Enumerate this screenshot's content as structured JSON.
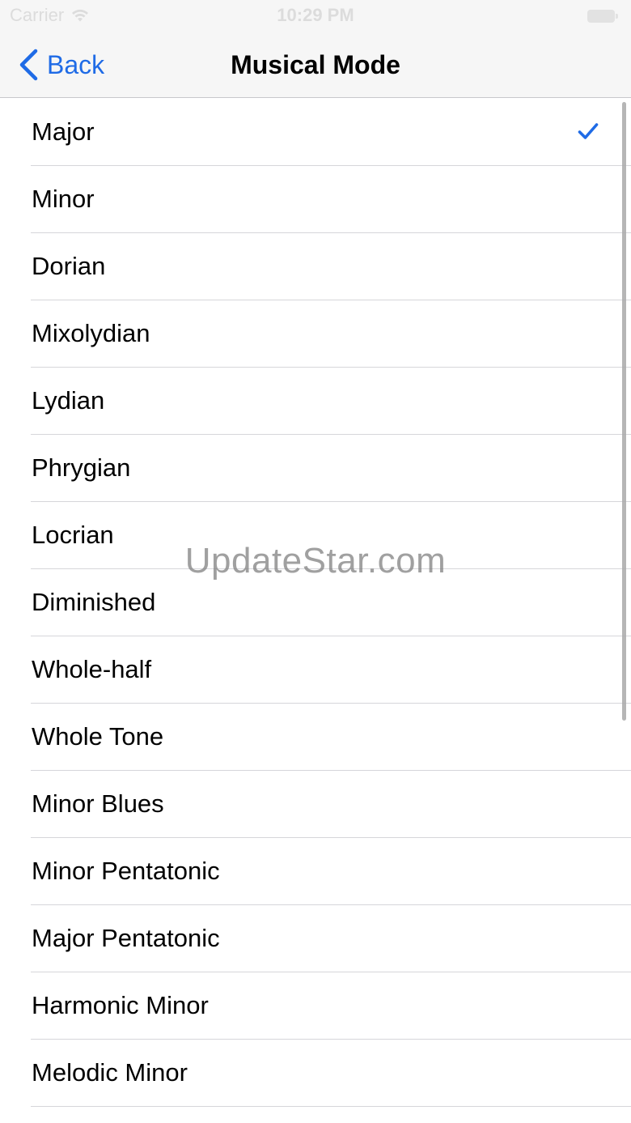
{
  "status_bar": {
    "carrier": "Carrier",
    "time": "10:29 PM",
    "wifi_icon": "wifi-icon",
    "battery_icon": "battery-icon"
  },
  "nav": {
    "back_label": "Back",
    "back_icon": "chevron-left-icon",
    "title": "Musical Mode"
  },
  "modes": [
    {
      "label": "Major",
      "selected": true
    },
    {
      "label": "Minor",
      "selected": false
    },
    {
      "label": "Dorian",
      "selected": false
    },
    {
      "label": "Mixolydian",
      "selected": false
    },
    {
      "label": "Lydian",
      "selected": false
    },
    {
      "label": "Phrygian",
      "selected": false
    },
    {
      "label": "Locrian",
      "selected": false
    },
    {
      "label": "Diminished",
      "selected": false
    },
    {
      "label": "Whole-half",
      "selected": false
    },
    {
      "label": "Whole Tone",
      "selected": false
    },
    {
      "label": "Minor Blues",
      "selected": false
    },
    {
      "label": "Minor Pentatonic",
      "selected": false
    },
    {
      "label": "Major Pentatonic",
      "selected": false
    },
    {
      "label": "Harmonic Minor",
      "selected": false
    },
    {
      "label": "Melodic Minor",
      "selected": false
    }
  ],
  "watermark": "UpdateStar.com",
  "colors": {
    "accent": "#1f6be6",
    "nav_background": "#f6f6f6",
    "separator": "#d6d6da"
  }
}
